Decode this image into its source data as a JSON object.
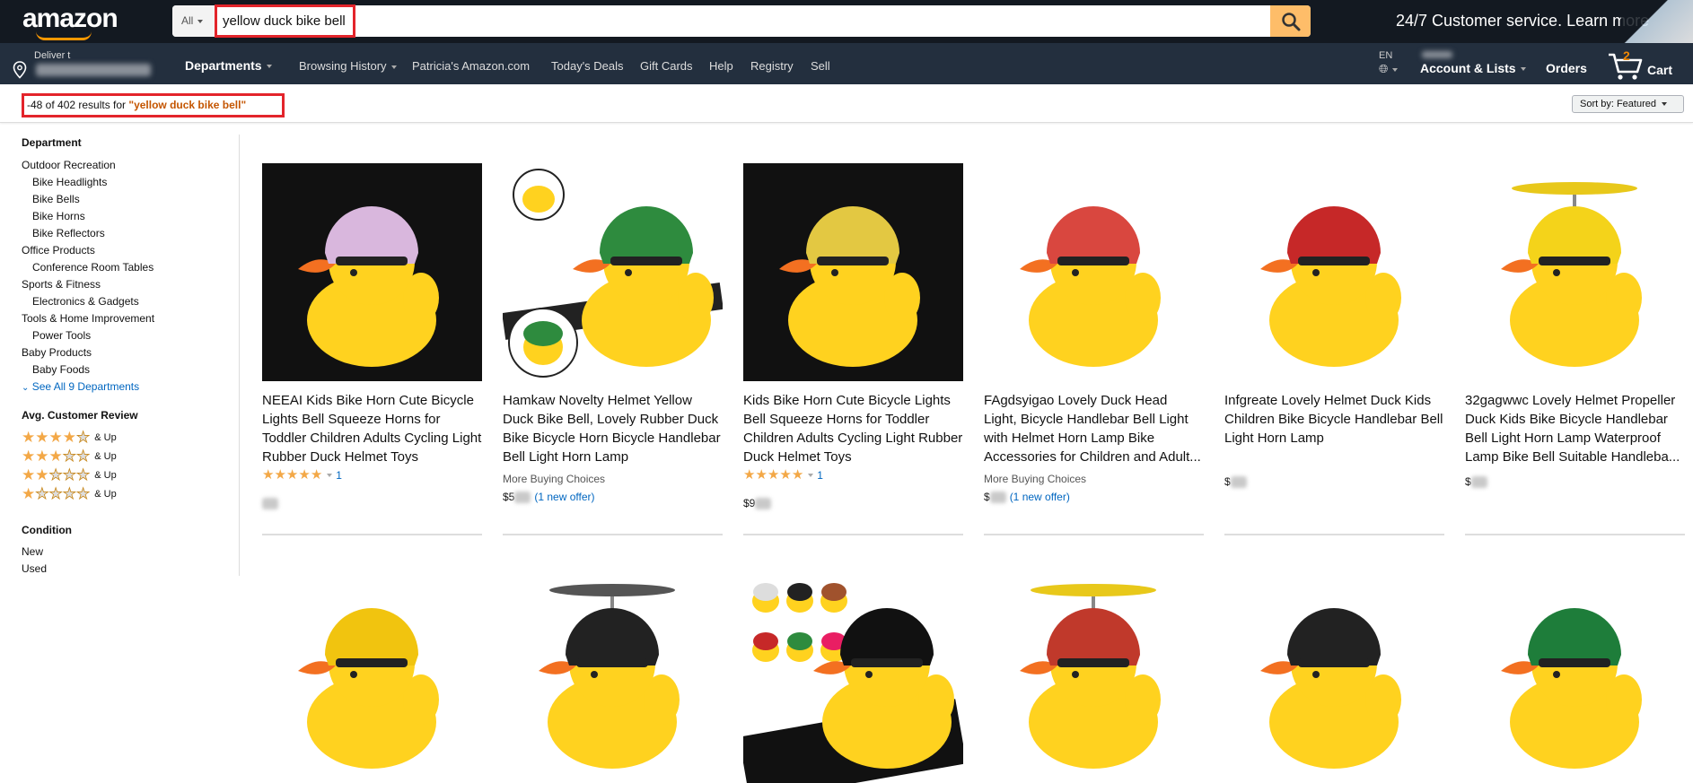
{
  "header": {
    "logo": "amazon",
    "search_category": "All",
    "search_query": "yellow duck bike bell",
    "promo": "24/7 Customer service. Learn more"
  },
  "nav": {
    "deliver_label": "Deliver t",
    "departments": "Departments",
    "browsing_history": "Browsing History",
    "patricias_amazon": "Patricia's Amazon.com",
    "todays_deals": "Today's Deals",
    "gift_cards": "Gift Cards",
    "help": "Help",
    "registry": "Registry",
    "sell": "Sell",
    "language": "EN",
    "account": "Account & Lists",
    "orders": "Orders",
    "cart_count": "2",
    "cart_label": "Cart"
  },
  "results": {
    "prefix": "-48 of 402 results for ",
    "query": "\"yellow duck bike bell\"",
    "sort": "Sort by:  Featured"
  },
  "sidebar": {
    "department_heading": "Department",
    "departments": [
      {
        "label": "Outdoor Recreation",
        "indent": false
      },
      {
        "label": "Bike Headlights",
        "indent": true
      },
      {
        "label": "Bike Bells",
        "indent": true
      },
      {
        "label": "Bike Horns",
        "indent": true
      },
      {
        "label": "Bike Reflectors",
        "indent": true
      },
      {
        "label": "Office Products",
        "indent": false
      },
      {
        "label": "Conference Room Tables",
        "indent": true
      },
      {
        "label": "Sports & Fitness",
        "indent": false
      },
      {
        "label": "Electronics & Gadgets",
        "indent": true
      },
      {
        "label": "Tools & Home Improvement",
        "indent": false
      },
      {
        "label": "Power Tools",
        "indent": true
      },
      {
        "label": "Baby Products",
        "indent": false
      },
      {
        "label": "Baby Foods",
        "indent": true
      }
    ],
    "see_all": "See All 9 Departments",
    "review_heading": "Avg. Customer Review",
    "review_rows": [
      {
        "stars": 4,
        "label": "& Up"
      },
      {
        "stars": 3,
        "label": "& Up"
      },
      {
        "stars": 2,
        "label": "& Up"
      },
      {
        "stars": 1,
        "label": "& Up"
      }
    ],
    "condition_heading": "Condition",
    "conditions": [
      "New",
      "Used"
    ]
  },
  "products": [
    {
      "title": "NEEAI Kids Bike Horn Cute Bicycle Lights Bell Squeeze Horns for Toddler Children Adults Cycling Light Rubber Duck Helmet Toys",
      "rating": 5,
      "reviews": "1",
      "more": "",
      "price": "",
      "offer": "",
      "helmet": "#d9b7dd",
      "bg": "#111111"
    },
    {
      "title": "Hamkaw Novelty Helmet Yellow Duck Bike Bell, Lovely Rubber Duck Bike Bicycle Horn Bicycle Handlebar Bell Light Horn Lamp",
      "rating": 0,
      "reviews": "",
      "more": "More Buying Choices",
      "price": "$5",
      "offer": "(1 new offer)",
      "helmet": "#2e8b3e",
      "bg": "#ffffff"
    },
    {
      "title": "Kids Bike Horn Cute Bicycle Lights Bell Squeeze Horns for Toddler Children Adults Cycling Light Rubber Duck Helmet Toys",
      "rating": 5,
      "reviews": "1",
      "more": "",
      "price": "$9",
      "offer": "",
      "helmet": "#e3c842",
      "bg": "#111111"
    },
    {
      "title": "FAgdsyigao Lovely Duck Head Light, Bicycle Handlebar Bell Light with Helmet Horn Lamp Bike Accessories for Children and Adult...",
      "rating": 0,
      "reviews": "",
      "more": "More Buying Choices",
      "price": "$",
      "offer": "(1 new offer)",
      "helmet": "#d9473f",
      "bg": "#ffffff"
    },
    {
      "title": "Infgreate Lovely Helmet Duck Kids Children Bike Bicycle Handlebar Bell Light Horn Lamp",
      "rating": 0,
      "reviews": "",
      "more": "",
      "price": "$",
      "offer": "",
      "helmet": "#c62828",
      "bg": "#ffffff"
    },
    {
      "title": "32gagwwc Lovely Helmet Propeller Duck Kids Bike Bicycle Handlebar Bell Light Horn Lamp Waterproof Lamp Bike Bell Suitable Handleba...",
      "rating": 0,
      "reviews": "",
      "more": "",
      "price": "$",
      "offer": "",
      "helmet": "#f4d31a",
      "bg": "#ffffff"
    },
    {
      "title": "",
      "helmet": "#f1c40f",
      "bg": "#ffffff"
    },
    {
      "title": "",
      "helmet": "#222222",
      "bg": "#ffffff"
    },
    {
      "title": "",
      "helmet": "#111111",
      "bg": "#ffffff"
    },
    {
      "title": "",
      "helmet": "#c0392b",
      "bg": "#ffffff"
    },
    {
      "title": "",
      "helmet": "#222222",
      "bg": "#ffffff"
    },
    {
      "title": "",
      "helmet": "#1e7d3a",
      "bg": "#ffffff"
    }
  ]
}
